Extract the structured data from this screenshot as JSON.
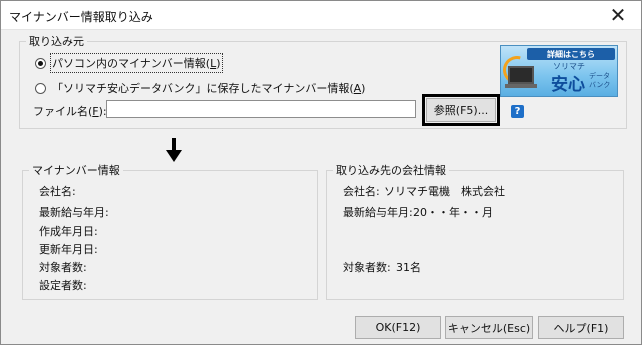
{
  "window": {
    "title": "マイナンバー情報取り込み",
    "close_label": "✕"
  },
  "source_group": {
    "legend": "取り込み元",
    "options": [
      {
        "label": "パソコン内のマイナンバー情報(",
        "shortcut": "L",
        "suffix": ")",
        "selected": true
      },
      {
        "label": "「ソリマチ安心データバンク」に保存したマイナンバー情報(",
        "shortcut": "A",
        "suffix": ")",
        "selected": false
      }
    ],
    "file_label_prefix": "ファイル名(",
    "file_label_key": "F",
    "file_label_suffix": "):",
    "file_value": "",
    "browse_label": "参照(F5)...",
    "help_label": "?"
  },
  "banner": {
    "badge": "詳細はこちら",
    "brand_small": "ソリマチ",
    "brand_big": "安心",
    "brand_side": "データバンク"
  },
  "my_number_group": {
    "legend": "マイナンバー情報",
    "fields": [
      {
        "label": "会社名:",
        "value": ""
      },
      {
        "label": "最新給与年月:",
        "value": ""
      },
      {
        "label": "作成年月日:",
        "value": ""
      },
      {
        "label": "更新年月日:",
        "value": ""
      },
      {
        "label": "対象者数:",
        "value": ""
      },
      {
        "label": "設定者数:",
        "value": ""
      }
    ]
  },
  "dest_group": {
    "legend": "取り込み先の会社情報",
    "company_label": "会社名:",
    "company_value": "ソリマチ電機　株式会社",
    "latest_label": "最新給与年月:",
    "latest_value": "20・・年・・月",
    "count_label": "対象者数:",
    "count_value": "31名"
  },
  "footer": {
    "ok_label": "OK(F12)",
    "cancel_label": "キャンセル(Esc)",
    "help_label": "ヘルプ(F1)"
  }
}
